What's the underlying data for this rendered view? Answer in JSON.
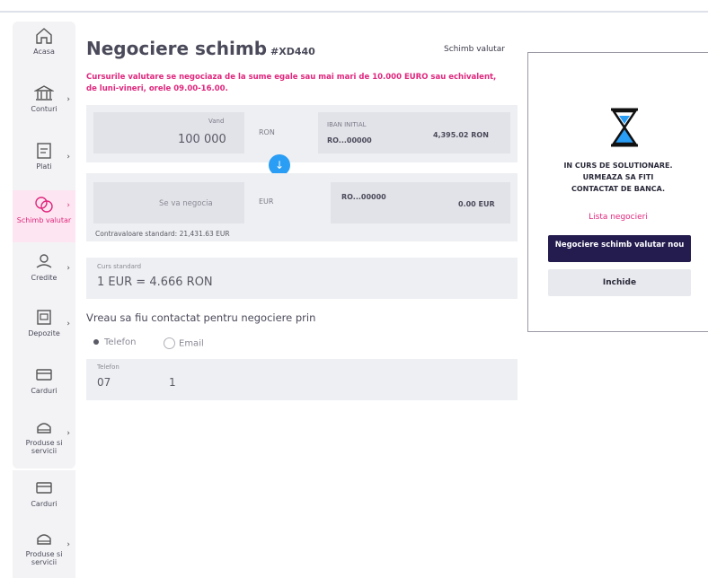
{
  "nav": {
    "items": [
      {
        "label": "Acasa",
        "icon": "home-icon"
      },
      {
        "label": "Conturi",
        "icon": "bank-icon"
      },
      {
        "label": "Plati",
        "icon": "payments-icon"
      },
      {
        "label": "Schimb valutar",
        "icon": "currency-exchange-icon",
        "active": true
      },
      {
        "label": "Credite",
        "icon": "credit-icon"
      },
      {
        "label": "Depozite",
        "icon": "deposit-icon"
      },
      {
        "label": "Carduri",
        "icon": "card-icon"
      },
      {
        "label": "Produse si servicii",
        "icon": "products-icon"
      }
    ],
    "secondary": [
      {
        "label": "Carduri",
        "icon": "card-icon"
      },
      {
        "label": "Produse si servicii",
        "icon": "products-icon"
      }
    ]
  },
  "page": {
    "title": "Negociere schimb",
    "code": "#XD440",
    "top_link": "Schimb valutar",
    "notice": "Cursurile valutare se negociaza de la sume egale sau mai mari de 10.000 EURO sau echivalent, de luni-vineri, orele 09.00-16.00."
  },
  "sell": {
    "label": "Vand",
    "amount": "100 000",
    "currency": "RON",
    "account_label": "IBAN INITIAL",
    "account": "RO...00000",
    "balance": "4,395.02 RON"
  },
  "buy": {
    "amount_placeholder": "Se va negocia",
    "currency": "EUR",
    "account": "RO...00000",
    "balance": "0.00 EUR"
  },
  "equivalent": "Contravaloare standard: 21,431.63 EUR",
  "rate": {
    "label": "Curs standard",
    "value": "1 EUR = 4.666 RON"
  },
  "contact": {
    "question": "Vreau sa fiu contactat pentru negociere prin",
    "option_phone": "Telefon",
    "option_email": "Email",
    "selected": "Telefon",
    "phone_label": "Telefon",
    "phone_prefix": "07",
    "phone_value": "1"
  },
  "modal": {
    "status_line1": "IN CURS DE SOLUTIONARE.",
    "status_line2": "URMEAZA SA FITI",
    "status_line3": "CONTACTAT DE BANCA.",
    "link": "Lista negocieri",
    "primary_button": "Negociere schimb valutar nou",
    "secondary_button": "Inchide"
  },
  "colors": {
    "accent": "#e0267d",
    "primary": "#241c4f",
    "swap": "#2a9df4",
    "hourglass_sand": "#2a9df4"
  }
}
